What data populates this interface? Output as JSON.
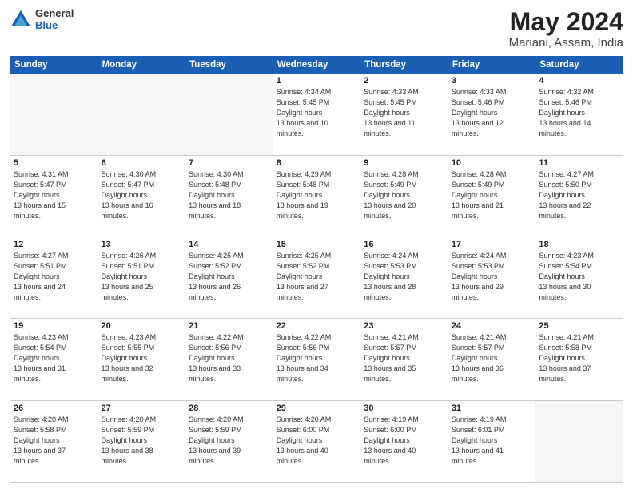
{
  "logo": {
    "general": "General",
    "blue": "Blue"
  },
  "header": {
    "title": "May 2024",
    "subtitle": "Mariani, Assam, India"
  },
  "weekdays": [
    "Sunday",
    "Monday",
    "Tuesday",
    "Wednesday",
    "Thursday",
    "Friday",
    "Saturday"
  ],
  "weeks": [
    [
      {
        "day": "",
        "empty": true
      },
      {
        "day": "",
        "empty": true
      },
      {
        "day": "",
        "empty": true
      },
      {
        "day": "1",
        "sunrise": "4:34 AM",
        "sunset": "5:45 PM",
        "daylight": "13 hours and 10 minutes."
      },
      {
        "day": "2",
        "sunrise": "4:33 AM",
        "sunset": "5:45 PM",
        "daylight": "13 hours and 11 minutes."
      },
      {
        "day": "3",
        "sunrise": "4:33 AM",
        "sunset": "5:46 PM",
        "daylight": "13 hours and 12 minutes."
      },
      {
        "day": "4",
        "sunrise": "4:32 AM",
        "sunset": "5:46 PM",
        "daylight": "13 hours and 14 minutes."
      }
    ],
    [
      {
        "day": "5",
        "sunrise": "4:31 AM",
        "sunset": "5:47 PM",
        "daylight": "13 hours and 15 minutes."
      },
      {
        "day": "6",
        "sunrise": "4:30 AM",
        "sunset": "5:47 PM",
        "daylight": "13 hours and 16 minutes."
      },
      {
        "day": "7",
        "sunrise": "4:30 AM",
        "sunset": "5:48 PM",
        "daylight": "13 hours and 18 minutes."
      },
      {
        "day": "8",
        "sunrise": "4:29 AM",
        "sunset": "5:48 PM",
        "daylight": "13 hours and 19 minutes."
      },
      {
        "day": "9",
        "sunrise": "4:28 AM",
        "sunset": "5:49 PM",
        "daylight": "13 hours and 20 minutes."
      },
      {
        "day": "10",
        "sunrise": "4:28 AM",
        "sunset": "5:49 PM",
        "daylight": "13 hours and 21 minutes."
      },
      {
        "day": "11",
        "sunrise": "4:27 AM",
        "sunset": "5:50 PM",
        "daylight": "13 hours and 22 minutes."
      }
    ],
    [
      {
        "day": "12",
        "sunrise": "4:27 AM",
        "sunset": "5:51 PM",
        "daylight": "13 hours and 24 minutes."
      },
      {
        "day": "13",
        "sunrise": "4:26 AM",
        "sunset": "5:51 PM",
        "daylight": "13 hours and 25 minutes."
      },
      {
        "day": "14",
        "sunrise": "4:25 AM",
        "sunset": "5:52 PM",
        "daylight": "13 hours and 26 minutes."
      },
      {
        "day": "15",
        "sunrise": "4:25 AM",
        "sunset": "5:52 PM",
        "daylight": "13 hours and 27 minutes."
      },
      {
        "day": "16",
        "sunrise": "4:24 AM",
        "sunset": "5:53 PM",
        "daylight": "13 hours and 28 minutes."
      },
      {
        "day": "17",
        "sunrise": "4:24 AM",
        "sunset": "5:53 PM",
        "daylight": "13 hours and 29 minutes."
      },
      {
        "day": "18",
        "sunrise": "4:23 AM",
        "sunset": "5:54 PM",
        "daylight": "13 hours and 30 minutes."
      }
    ],
    [
      {
        "day": "19",
        "sunrise": "4:23 AM",
        "sunset": "5:54 PM",
        "daylight": "13 hours and 31 minutes."
      },
      {
        "day": "20",
        "sunrise": "4:23 AM",
        "sunset": "5:55 PM",
        "daylight": "13 hours and 32 minutes."
      },
      {
        "day": "21",
        "sunrise": "4:22 AM",
        "sunset": "5:56 PM",
        "daylight": "13 hours and 33 minutes."
      },
      {
        "day": "22",
        "sunrise": "4:22 AM",
        "sunset": "5:56 PM",
        "daylight": "13 hours and 34 minutes."
      },
      {
        "day": "23",
        "sunrise": "4:21 AM",
        "sunset": "5:57 PM",
        "daylight": "13 hours and 35 minutes."
      },
      {
        "day": "24",
        "sunrise": "4:21 AM",
        "sunset": "5:57 PM",
        "daylight": "13 hours and 36 minutes."
      },
      {
        "day": "25",
        "sunrise": "4:21 AM",
        "sunset": "5:58 PM",
        "daylight": "13 hours and 37 minutes."
      }
    ],
    [
      {
        "day": "26",
        "sunrise": "4:20 AM",
        "sunset": "5:58 PM",
        "daylight": "13 hours and 37 minutes."
      },
      {
        "day": "27",
        "sunrise": "4:20 AM",
        "sunset": "5:59 PM",
        "daylight": "13 hours and 38 minutes."
      },
      {
        "day": "28",
        "sunrise": "4:20 AM",
        "sunset": "5:59 PM",
        "daylight": "13 hours and 39 minutes."
      },
      {
        "day": "29",
        "sunrise": "4:20 AM",
        "sunset": "6:00 PM",
        "daylight": "13 hours and 40 minutes."
      },
      {
        "day": "30",
        "sunrise": "4:19 AM",
        "sunset": "6:00 PM",
        "daylight": "13 hours and 40 minutes."
      },
      {
        "day": "31",
        "sunrise": "4:19 AM",
        "sunset": "6:01 PM",
        "daylight": "13 hours and 41 minutes."
      },
      {
        "day": "",
        "empty": true
      }
    ]
  ]
}
